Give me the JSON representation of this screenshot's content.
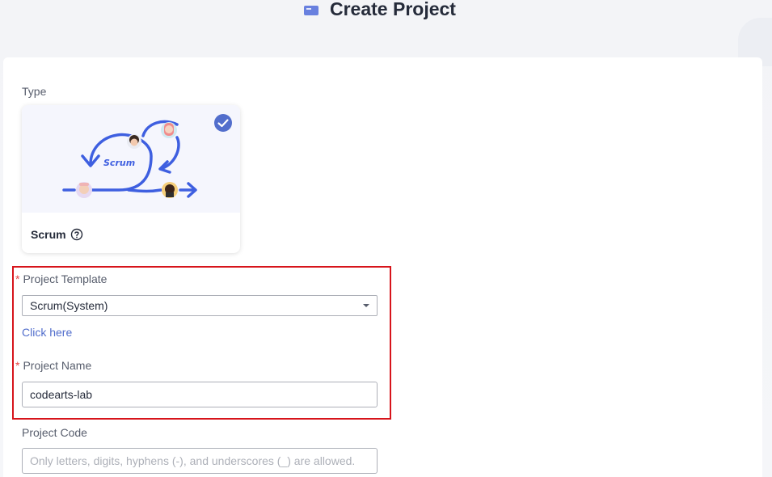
{
  "header": {
    "title": "Create Project"
  },
  "form": {
    "type_label": "Type",
    "type_card": {
      "name": "Scrum",
      "illustration_text": "Scrum",
      "selected": true
    },
    "template": {
      "label": "Project Template",
      "value": "Scrum(System)",
      "link": "Click here"
    },
    "project_name": {
      "label": "Project Name",
      "value": "codearts-lab"
    },
    "project_code": {
      "label": "Project Code",
      "placeholder": "Only letters, digits, hyphens (-), and underscores (_) are allowed."
    },
    "required_mark": "*"
  },
  "colors": {
    "accent": "#526ecc",
    "scrum_blue": "#3e5fe0",
    "required": "#e54545",
    "highlight_border": "#d7141b"
  }
}
